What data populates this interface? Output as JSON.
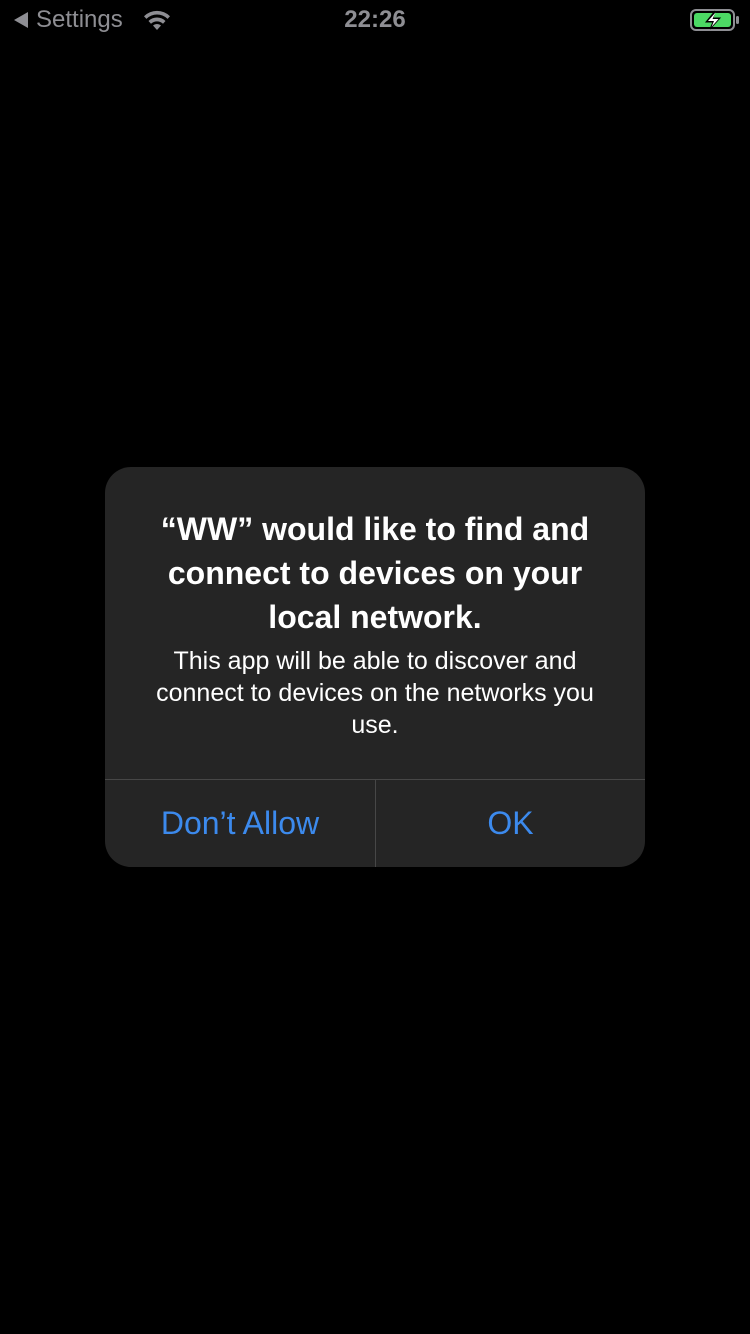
{
  "status_bar": {
    "back_label": "Settings",
    "time": "22:26",
    "icons": {
      "back": "back-arrow-icon",
      "wifi": "wifi-icon",
      "battery": "battery-charging-icon"
    },
    "battery_color": "#4cd964"
  },
  "alert": {
    "title": "“WW” would like to find and connect to devices on your local network.",
    "message": "This app will be able to discover and connect to devices on the networks you use.",
    "buttons": {
      "deny": "Don’t Allow",
      "ok": "OK"
    },
    "accent_color": "#3c8aed"
  }
}
